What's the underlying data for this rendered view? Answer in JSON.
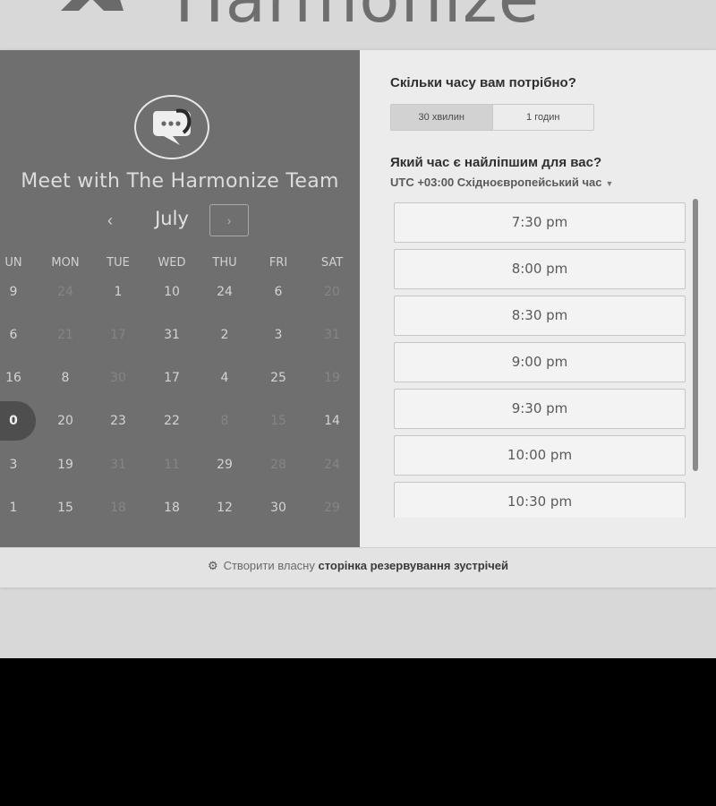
{
  "brand": {
    "name": "Harmonize"
  },
  "calendar": {
    "team_name": "Meet with The Harmonize Team",
    "month": "July",
    "prev_glyph": "‹",
    "next_glyph": "›",
    "weekdays": [
      "UN",
      "MON",
      "TUE",
      "WED",
      "THU",
      "FRI",
      "SAT"
    ],
    "rows": [
      [
        "9",
        "24",
        "1",
        "10",
        "24",
        "6",
        "20"
      ],
      [
        "6",
        "21",
        "17",
        "31",
        "2",
        "3",
        "31"
      ],
      [
        "16",
        "8",
        "30",
        "17",
        "4",
        "25",
        "19"
      ],
      [
        "0",
        "20",
        "23",
        "22",
        "8",
        "15",
        "14"
      ],
      [
        "3",
        "19",
        "31",
        "11",
        "29",
        "28",
        "24"
      ],
      [
        "1",
        "15",
        "18",
        "18",
        "12",
        "30",
        "29"
      ]
    ],
    "dim_cells": [
      [
        0,
        1
      ],
      [
        0,
        6
      ],
      [
        1,
        1
      ],
      [
        1,
        2
      ],
      [
        1,
        6
      ],
      [
        2,
        2
      ],
      [
        2,
        6
      ],
      [
        3,
        4
      ],
      [
        3,
        5
      ],
      [
        4,
        2
      ],
      [
        4,
        3
      ],
      [
        4,
        5
      ],
      [
        4,
        6
      ],
      [
        5,
        2
      ],
      [
        5,
        6
      ]
    ]
  },
  "booking": {
    "duration_question": "Скільки часу вам потрібно?",
    "durations": [
      "30 хвилин",
      "1 годин"
    ],
    "time_question": "Який час є найліпшим для вас?",
    "timezone": "UTC +03:00 Східноєвропейський час",
    "slots": [
      "7:30 pm",
      "8:00 pm",
      "8:30 pm",
      "9:00 pm",
      "9:30 pm",
      "10:00 pm",
      "10:30 pm"
    ]
  },
  "footer": {
    "prefix": "Створити власну ",
    "strong": "сторінка резервування зустрічей"
  },
  "colors": {
    "left_panel": "#6f6f6f",
    "right_panel": "#ececec",
    "page": "#d8d8d8"
  }
}
